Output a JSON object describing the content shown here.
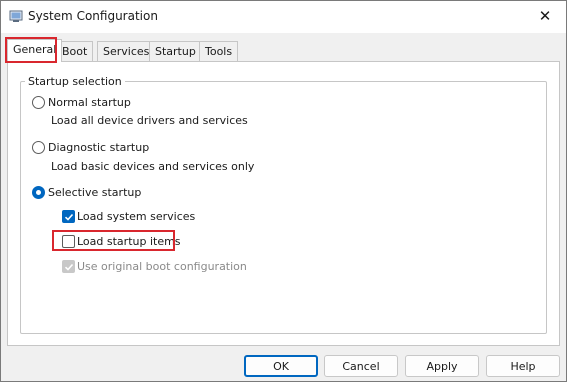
{
  "window": {
    "title": "System Configuration",
    "close_glyph": "✕"
  },
  "tabs": [
    {
      "label": "General",
      "active": true
    },
    {
      "label": "Boot",
      "active": false
    },
    {
      "label": "Services",
      "active": false
    },
    {
      "label": "Startup",
      "active": false
    },
    {
      "label": "Tools",
      "active": false
    }
  ],
  "startup_selection": {
    "group_label": "Startup selection",
    "options": [
      {
        "label": "Normal startup",
        "description": "Load all device drivers and services",
        "selected": false
      },
      {
        "label": "Diagnostic startup",
        "description": "Load basic devices and services only",
        "selected": false
      },
      {
        "label": "Selective startup",
        "selected": true
      }
    ],
    "selective_items": [
      {
        "label": "Load system services",
        "checked": true,
        "enabled": true
      },
      {
        "label": "Load startup items",
        "checked": false,
        "enabled": true
      },
      {
        "label": "Use original boot configuration",
        "checked": true,
        "enabled": false
      }
    ]
  },
  "buttons": {
    "ok": "OK",
    "cancel": "Cancel",
    "apply": "Apply",
    "help": "Help"
  },
  "colors": {
    "accent": "#0067c0",
    "highlight": "#d9272e"
  }
}
